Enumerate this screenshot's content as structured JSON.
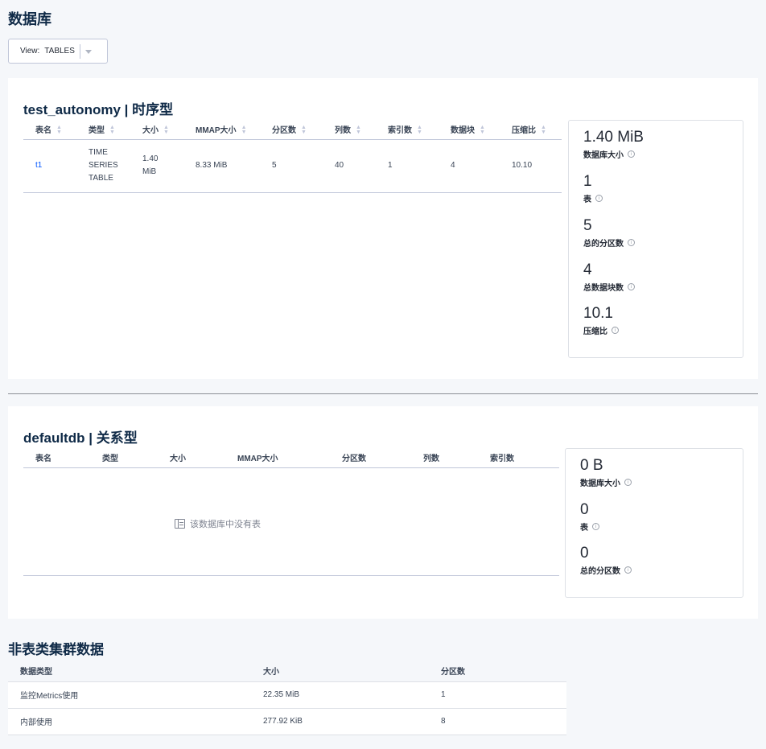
{
  "page_title": "数据库",
  "view_select": {
    "label": "View:",
    "value": "TABLES"
  },
  "databases": [
    {
      "title": "test_autonomy | 时序型",
      "columns": [
        "表名",
        "类型",
        "大小",
        "MMAP大小",
        "分区数",
        "列数",
        "索引数",
        "数据块",
        "压缩比"
      ],
      "rows": [
        {
          "name": "t1",
          "type_lines": [
            "TIME",
            "SERIES",
            "TABLE"
          ],
          "size_lines": [
            "1.40",
            "MiB"
          ],
          "mmap": "8.33 MiB",
          "partitions": "5",
          "columns": "40",
          "indexes": "1",
          "blocks": "4",
          "ratio": "10.10"
        }
      ],
      "stats": [
        {
          "value": "1.40 MiB",
          "label": "数据库大小"
        },
        {
          "value": "1",
          "label": "表"
        },
        {
          "value": "5",
          "label": "总的分区数"
        },
        {
          "value": "4",
          "label": "总数据块数"
        },
        {
          "value": "10.1",
          "label": "压缩比"
        }
      ]
    },
    {
      "title": "defaultdb | 关系型",
      "columns": [
        "表名",
        "类型",
        "大小",
        "MMAP大小",
        "分区数",
        "列数",
        "索引数"
      ],
      "empty_text": "该数据库中没有表",
      "stats": [
        {
          "value": "0 B",
          "label": "数据库大小"
        },
        {
          "value": "0",
          "label": "表"
        },
        {
          "value": "0",
          "label": "总的分区数"
        }
      ]
    }
  ],
  "non_table": {
    "title": "非表类集群数据",
    "columns": [
      "数据类型",
      "大小",
      "分区数"
    ],
    "rows": [
      [
        "监控Metrics使用",
        "22.35 MiB",
        "1"
      ],
      [
        "内部使用",
        "277.92 KiB",
        "8"
      ]
    ]
  },
  "info_glyph": "i",
  "sort_glyph": {
    "up": "▲",
    "down": "▼"
  }
}
